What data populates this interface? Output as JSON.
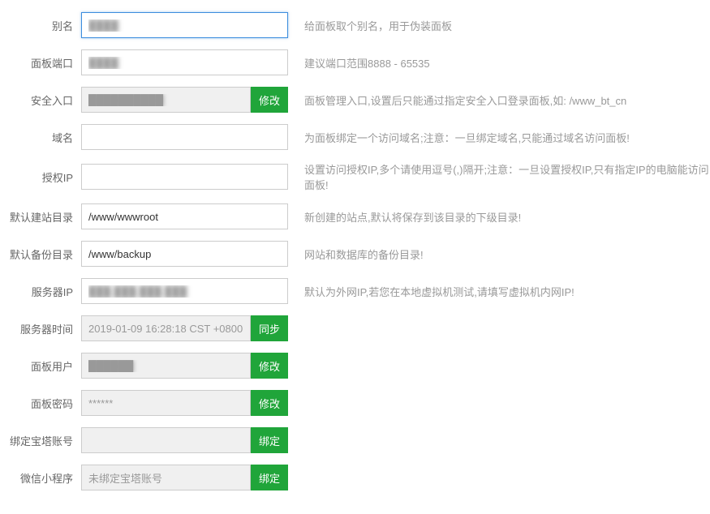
{
  "rows": {
    "alias": {
      "label": "别名",
      "value": "████",
      "hint": "给面板取个别名，用于伪装面板"
    },
    "port": {
      "label": "面板端口",
      "value": "████",
      "hint": "建议端口范围8888 - 65535"
    },
    "entry": {
      "label": "安全入口",
      "value": "██████████",
      "button": "修改",
      "hint": "面板管理入口,设置后只能通过指定安全入口登录面板,如: /www_bt_cn"
    },
    "domain": {
      "label": "域名",
      "value": "",
      "hint": "为面板绑定一个访问域名;注意：一旦绑定域名,只能通过域名访问面板!"
    },
    "authip": {
      "label": "授权IP",
      "value": "",
      "hint": "设置访问授权IP,多个请使用逗号(,)隔开;注意：一旦设置授权IP,只有指定IP的电脑能访问面板!"
    },
    "sitedir": {
      "label": "默认建站目录",
      "value": "/www/wwwroot",
      "hint": "新创建的站点,默认将保存到该目录的下级目录!"
    },
    "backupdir": {
      "label": "默认备份目录",
      "value": "/www/backup",
      "hint": "网站和数据库的备份目录!"
    },
    "serverip": {
      "label": "服务器IP",
      "value": "███.███.███.███",
      "hint": "默认为外网IP,若您在本地虚拟机测试,请填写虚拟机内网IP!"
    },
    "servertime": {
      "label": "服务器时间",
      "value": "2019-01-09 16:28:18 CST +0800",
      "button": "同步"
    },
    "paneluser": {
      "label": "面板用户",
      "value": "██████",
      "button": "修改"
    },
    "panelpass": {
      "label": "面板密码",
      "value": "******",
      "button": "修改"
    },
    "btaccount": {
      "label": "绑定宝塔账号",
      "value": "",
      "button": "绑定"
    },
    "wechat": {
      "label": "微信小程序",
      "value": "未绑定宝塔账号",
      "button": "绑定"
    }
  }
}
